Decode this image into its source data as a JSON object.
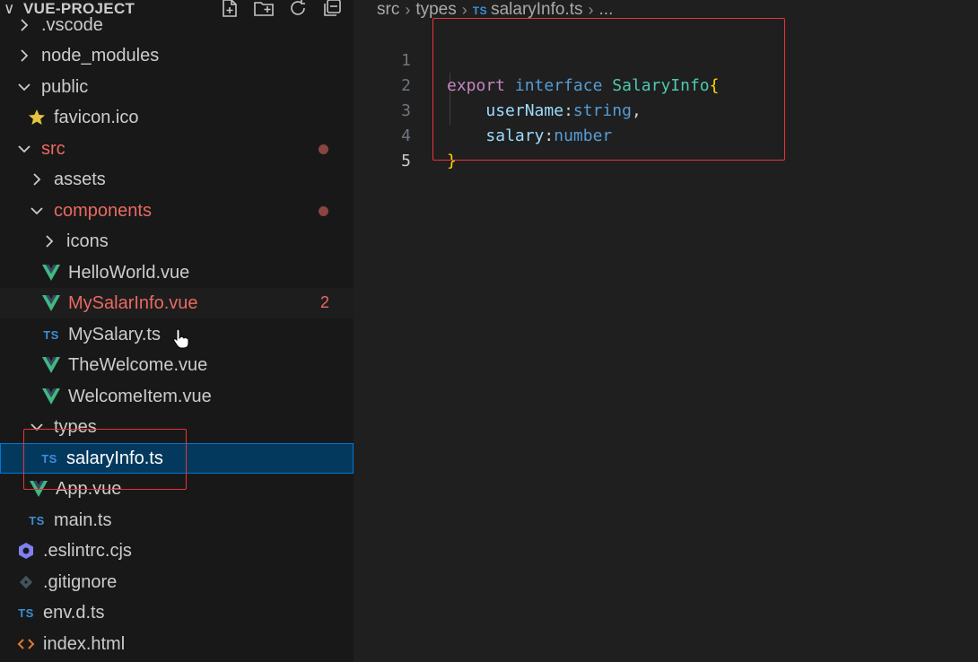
{
  "explorer": {
    "title": "VUE-PROJECT",
    "actions": [
      "new-file-icon",
      "new-folder-icon",
      "refresh-icon",
      "collapse-all-icon"
    ],
    "items": [
      {
        "label": ".vscode",
        "kind": "folder-collapsed"
      },
      {
        "label": "node_modules",
        "kind": "folder-collapsed"
      },
      {
        "label": "public",
        "kind": "folder-expanded"
      },
      {
        "label": "favicon.ico",
        "kind": "star-file"
      },
      {
        "label": "src",
        "kind": "folder-expanded",
        "modified": true
      },
      {
        "label": "assets",
        "kind": "folder-collapsed"
      },
      {
        "label": "components",
        "kind": "folder-expanded",
        "modified": true
      },
      {
        "label": "icons",
        "kind": "folder-collapsed"
      },
      {
        "label": "HelloWorld.vue",
        "kind": "vue"
      },
      {
        "label": "MySalarInfo.vue",
        "kind": "vue",
        "modified": true,
        "badge": "2"
      },
      {
        "label": "MySalary.ts",
        "kind": "ts"
      },
      {
        "label": "TheWelcome.vue",
        "kind": "vue"
      },
      {
        "label": "WelcomeItem.vue",
        "kind": "vue"
      },
      {
        "label": "types",
        "kind": "folder-expanded"
      },
      {
        "label": "salaryInfo.ts",
        "kind": "ts",
        "selected": true
      },
      {
        "label": "App.vue",
        "kind": "vue"
      },
      {
        "label": "main.ts",
        "kind": "ts"
      },
      {
        "label": ".eslintrc.cjs",
        "kind": "eslint"
      },
      {
        "label": ".gitignore",
        "kind": "git"
      },
      {
        "label": "env.d.ts",
        "kind": "ts"
      },
      {
        "label": "index.html",
        "kind": "html"
      }
    ]
  },
  "icons": {
    "ts": "TS"
  },
  "breadcrumb": {
    "part1": "src",
    "part2": "types",
    "file": "salaryInfo.ts",
    "more": "..."
  },
  "code": {
    "lines": [
      {
        "n": "1",
        "tokens": [
          "export",
          "interface",
          "SalaryInfo",
          "{"
        ]
      },
      {
        "n": "2",
        "tokens": [
          "userName",
          ":",
          "string",
          ","
        ]
      },
      {
        "n": "3",
        "tokens": [
          "salary",
          ":",
          "number"
        ]
      },
      {
        "n": "4",
        "tokens": [
          "}"
        ]
      },
      {
        "n": "5",
        "tokens": []
      }
    ]
  },
  "colors": {
    "keyword": "#c586c0",
    "keyword2": "#569cd6",
    "type": "#4ec9b0",
    "property": "#9cdcfe",
    "brace": "#ffd700",
    "modified": "#e96a61",
    "selection": "#04395e",
    "highlight": "#e8333a"
  }
}
